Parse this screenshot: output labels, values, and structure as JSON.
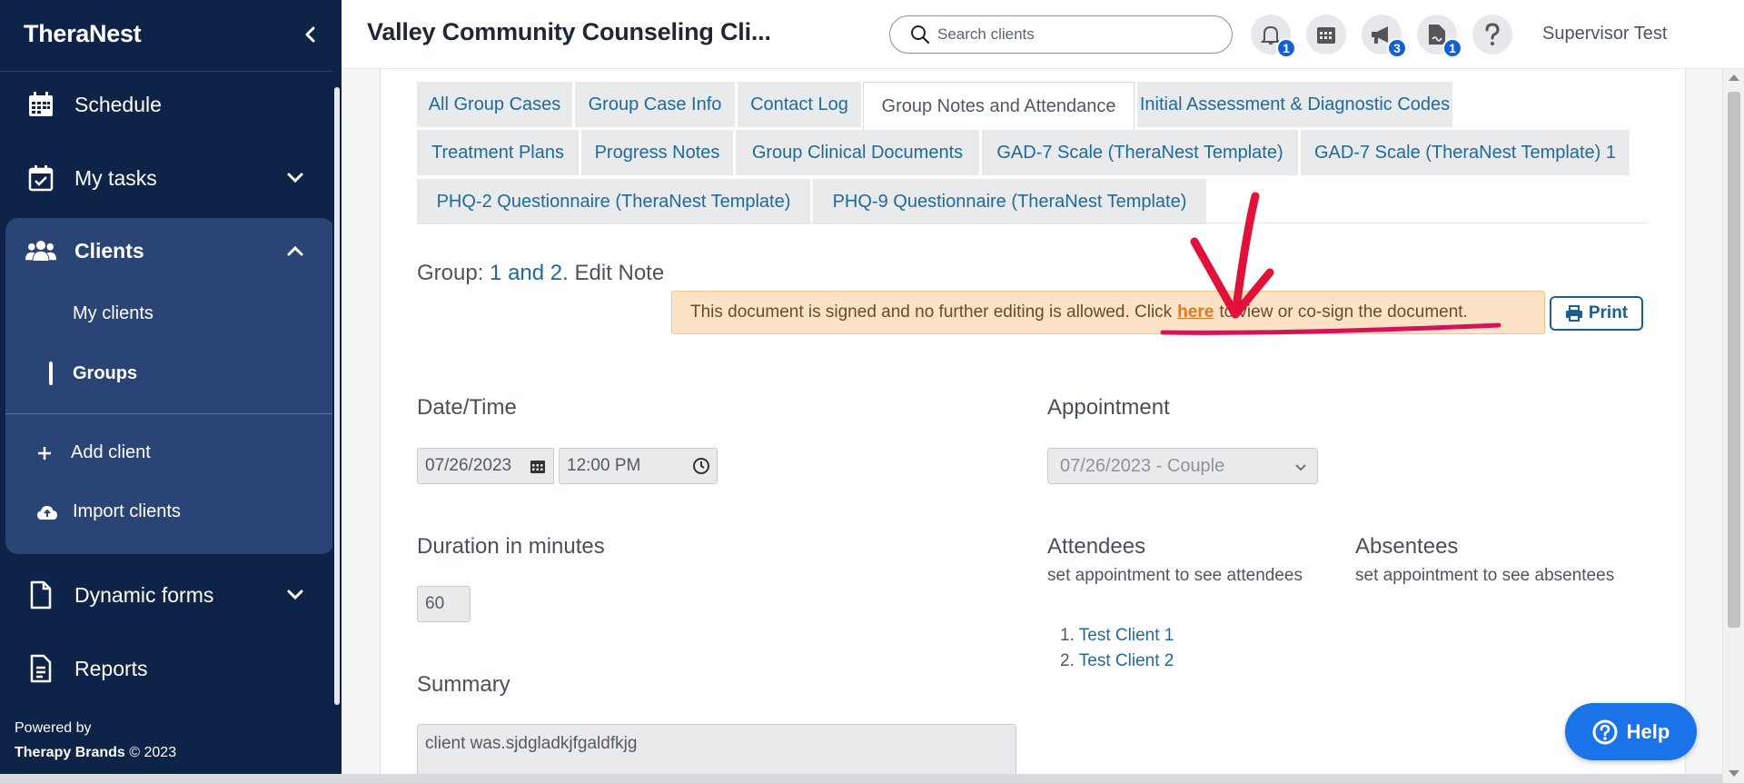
{
  "sidebar": {
    "brand": "TheraNest",
    "items": [
      {
        "label": "Schedule",
        "icon": "calendar-icon"
      },
      {
        "label": "My tasks",
        "icon": "task-check-icon"
      },
      {
        "label": "Clients",
        "icon": "users-icon"
      },
      {
        "label": "Dynamic forms",
        "icon": "document-icon"
      },
      {
        "label": "Reports",
        "icon": "report-icon"
      }
    ],
    "clients_sub": [
      "My clients",
      "Groups"
    ],
    "clients_actions": [
      "Add client",
      "Import clients"
    ],
    "powered_by": "Powered by",
    "company": "Therapy Brands",
    "copyright": "© 2023"
  },
  "header": {
    "practice_name": "Valley Community Counseling Cli...",
    "search_placeholder": "Search clients",
    "notifications_count": "1",
    "announcements_count": "3",
    "documents_count": "1",
    "user_name": "Supervisor Test"
  },
  "tabs": [
    "All Group Cases",
    "Group Case Info",
    "Contact Log",
    "Group Notes and Attendance",
    "Initial Assessment & Diagnostic Codes",
    "Treatment Plans",
    "Progress Notes",
    "Group Clinical Documents",
    "GAD-7 Scale (TheraNest Template)",
    "GAD-7 Scale (TheraNest Template) 1",
    "PHQ-2 Questionnaire (TheraNest Template)",
    "PHQ-9 Questionnaire (TheraNest Template)"
  ],
  "active_tab": "Group Notes and Attendance",
  "note": {
    "group_prefix": "Group: ",
    "group_name": "1 and 2",
    "title_suffix": ". Edit Note",
    "alert_before": "This document is signed and no further editing is allowed. Click",
    "alert_link": "here",
    "alert_after": "to view or co-sign the document.",
    "print_label": "Print",
    "datetime_label": "Date/Time",
    "date_value": "07/26/2023",
    "time_value": "12:00 PM",
    "appointment_label": "Appointment",
    "appointment_value": "07/26/2023 - Couple",
    "duration_label": "Duration in minutes",
    "duration_value": "60",
    "attendees_label": "Attendees",
    "attendees_help": "set appointment to see attendees",
    "absentees_label": "Absentees",
    "absentees_help": "set appointment to see absentees",
    "attendees": [
      "Test Client 1",
      "Test Client 2"
    ],
    "summary_label": "Summary",
    "summary_value": "client was.sjdgladkjfgaldfkjg"
  },
  "help_label": "Help",
  "colors": {
    "sidebar_bg": "#0d2448",
    "clients_panel_bg": "#2a4476",
    "link": "#1e6a9c",
    "alert_bg": "#fde3c6",
    "help_btn": "#1a73e8",
    "badge": "#1460d0",
    "annotation": "#e0123a"
  }
}
